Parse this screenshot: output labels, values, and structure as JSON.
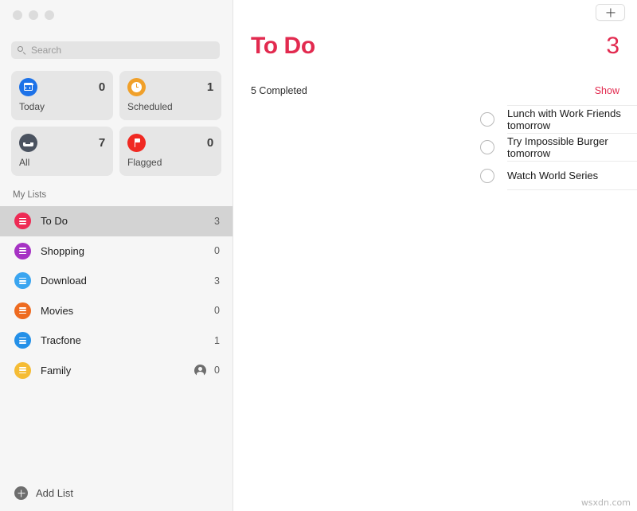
{
  "window": {
    "traffic_lights": [
      "close",
      "minimize",
      "zoom"
    ]
  },
  "sidebar": {
    "search": {
      "placeholder": "Search",
      "value": "",
      "icon": "search-icon"
    },
    "smart_lists": [
      {
        "label": "Today",
        "count": "0",
        "icon": "calendar-icon",
        "color": "#1d72e8"
      },
      {
        "label": "Scheduled",
        "count": "1",
        "icon": "clock-icon",
        "color": "#f0a02a"
      },
      {
        "label": "All",
        "count": "7",
        "icon": "tray-icon",
        "color": "#4b5360"
      },
      {
        "label": "Flagged",
        "count": "0",
        "icon": "flag-icon",
        "color": "#f02922"
      }
    ],
    "my_lists_header": "My Lists",
    "lists": [
      {
        "label": "To Do",
        "count": "3",
        "color": "#ee2b55",
        "selected": true,
        "shared": false
      },
      {
        "label": "Shopping",
        "count": "0",
        "color": "#a633c4",
        "selected": false,
        "shared": false
      },
      {
        "label": "Download",
        "count": "3",
        "color": "#3aa5f0",
        "selected": false,
        "shared": false
      },
      {
        "label": "Movies",
        "count": "0",
        "color": "#ee6b20",
        "selected": false,
        "shared": false
      },
      {
        "label": "Tracfone",
        "count": "1",
        "color": "#2490e8",
        "selected": false,
        "shared": false
      },
      {
        "label": "Family",
        "count": "0",
        "color": "#f5bc35",
        "selected": false,
        "shared": true
      }
    ],
    "add_list": {
      "label": "Add List",
      "icon": "plus-circle-icon"
    }
  },
  "main": {
    "add_reminder_button": {
      "icon": "plus-icon"
    },
    "title": "To Do",
    "title_color": "#e22a4f",
    "total_count": "3",
    "completed_text": "5 Completed",
    "show_link": "Show",
    "tasks": [
      {
        "title": "Lunch with Work Friends tomorrow",
        "done": false
      },
      {
        "title": "Try Impossible Burger tomorrow",
        "done": false
      },
      {
        "title": "Watch World Series",
        "done": false
      }
    ]
  },
  "watermark": "wsxdn.com"
}
